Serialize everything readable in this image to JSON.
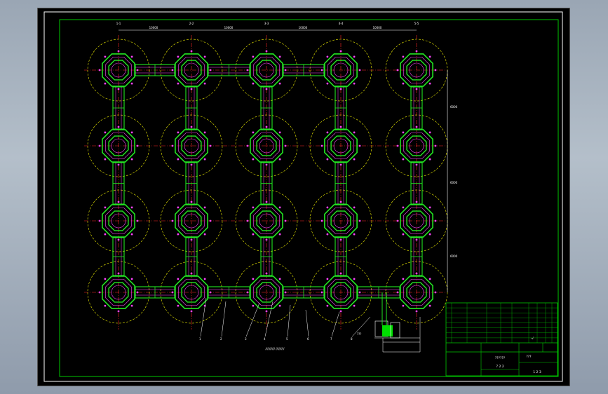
{
  "colors": {
    "canvas": "#000000",
    "frame": "#ffffff",
    "inner_border": "#00c800",
    "structure": "#22e622",
    "structure_inner": "#ff44ff",
    "centerline": "#ff2a2a",
    "pile_circle": "#f0f000",
    "dimension": "#ffffff",
    "detail_fill": "#00dd00"
  },
  "icons": {
    "pile_cap": "octagon-pile-cap-icon",
    "pile_circle": "dashed-circle-icon"
  },
  "drawing": {
    "grid_columns": 5,
    "grid_rows": 4,
    "top_dimension_labels": [
      "10000",
      "10000",
      "10000",
      "10000"
    ],
    "column_axis_labels": [
      "1-1",
      "2-2",
      "3-3",
      "4-4",
      "5-5"
    ],
    "right_dimension_labels": [
      "6000",
      "6000",
      "6000"
    ],
    "callout_labels": [
      "1",
      "2",
      "3",
      "4",
      "5",
      "6",
      "7",
      "8"
    ],
    "scale_note": "////////// /////////",
    "detail_label": "???"
  },
  "title_block": {
    "rows_upper": 8,
    "sub_left_label": "7 2 2",
    "name_text": "??????",
    "drawing_no": "???",
    "sheet_text": "1 2 3",
    "grade_mark": "-√"
  }
}
